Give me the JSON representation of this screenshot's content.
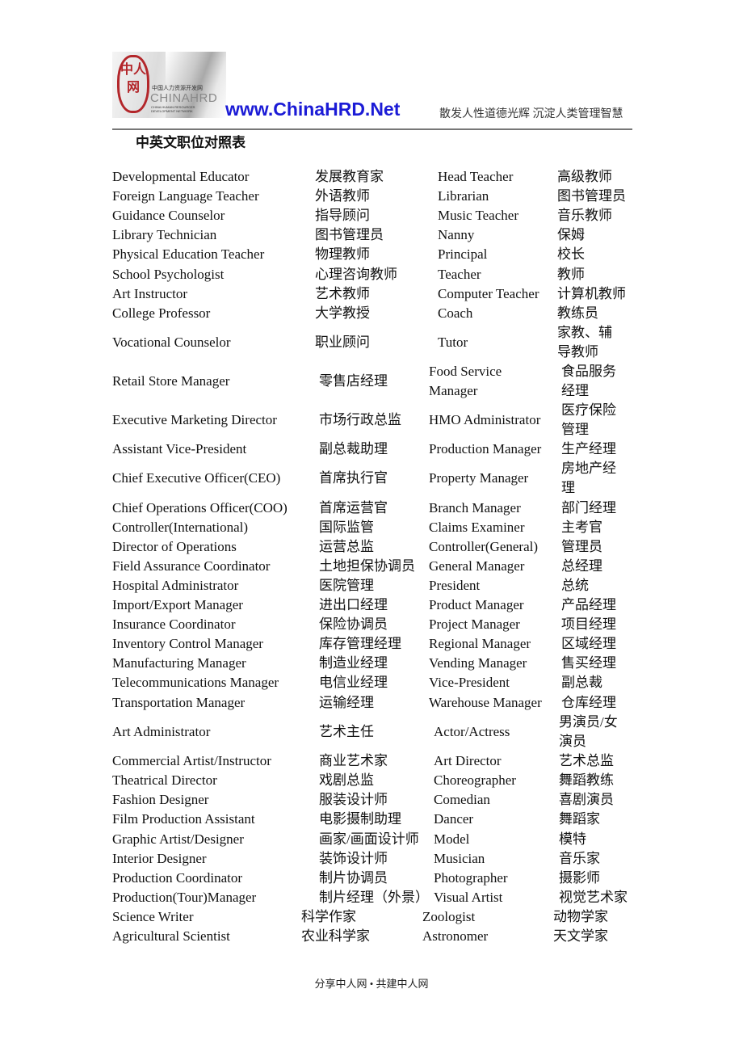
{
  "header": {
    "logo_text": "中人网",
    "logo_cn": "中国人力资源开发网",
    "logo_en": "CHINAHRD",
    "logo_sub": "CHINA HUMAN RESOURCES DEVELOPMENT NETWORK",
    "site": "www.ChinaHRD.Net",
    "slogan": "散发人性道德光辉 沉淀人类管理智慧"
  },
  "title": "中英文职位对照表",
  "rows": [
    [
      "Developmental Educator",
      "发展教育家",
      "Head Teacher",
      "高级教师"
    ],
    [
      "Foreign Language Teacher",
      "外语教师",
      "Librarian",
      "图书管理员"
    ],
    [
      "Guidance Counselor",
      "指导顾问",
      "Music Teacher",
      "音乐教师"
    ],
    [
      "Library Technician",
      "图书管理员",
      "Nanny",
      "保姆"
    ],
    [
      "Physical Education Teacher",
      "物理教师",
      "Principal",
      "校长"
    ],
    [
      "School Psychologist",
      "心理咨询教师",
      "Teacher",
      "教师"
    ],
    [
      "Art Instructor",
      "艺术教师",
      "Computer Teacher",
      "计算机教师"
    ],
    [
      "College Professor",
      "大学教授",
      "Coach",
      "教练员"
    ],
    [
      "Vocational Counselor",
      "职业顾问",
      "Tutor",
      "家教、辅导教师"
    ],
    [
      "Retail Store Manager",
      "零售店经理",
      "Food Service Manager",
      "食品服务经理"
    ],
    [
      "Executive Marketing Director",
      "市场行政总监",
      "HMO Administrator",
      "医疗保险管理"
    ],
    [
      "Assistant Vice-President",
      "副总裁助理",
      "Production Manager",
      "生产经理"
    ],
    [
      "Chief Executive Officer(CEO)",
      "首席执行官",
      "Property Manager",
      "房地产经理"
    ],
    [
      "Chief Operations Officer(COO)",
      "首席运营官",
      "Branch Manager",
      "部门经理"
    ],
    [
      "Controller(International)",
      "国际监管",
      "Claims Examiner",
      "主考官"
    ],
    [
      "Director of Operations",
      "运营总监",
      "Controller(General)",
      "管理员"
    ],
    [
      "Field Assurance Coordinator",
      "土地担保协调员",
      "General Manager",
      "总经理"
    ],
    [
      "Hospital Administrator",
      "医院管理",
      "President",
      "总统"
    ],
    [
      "Import/Export Manager",
      "进出口经理",
      "Product Manager",
      "产品经理"
    ],
    [
      "Insurance Coordinator",
      "保险协调员",
      "Project Manager",
      "项目经理"
    ],
    [
      "Inventory Control Manager",
      "库存管理经理",
      "Regional Manager",
      "区域经理"
    ],
    [
      "Manufacturing Manager",
      "制造业经理",
      "Vending Manager",
      "售买经理"
    ],
    [
      "Telecommunications Manager",
      "电信业经理",
      "Vice-President",
      "副总裁"
    ],
    [
      "Transportation Manager",
      "运输经理",
      "Warehouse Manager",
      "仓库经理"
    ],
    [
      "Art Administrator",
      "艺术主任",
      "Actor/Actress",
      "男演员/女演员"
    ],
    [
      "Commercial Artist/Instructor",
      "商业艺术家",
      "Art Director",
      "艺术总监"
    ],
    [
      "Theatrical Director",
      "戏剧总监",
      "Choreographer",
      "舞蹈教练"
    ],
    [
      "Fashion Designer",
      "服装设计师",
      "Comedian",
      "喜剧演员"
    ],
    [
      "Film Production Assistant",
      "电影摄制助理",
      "Dancer",
      "舞蹈家"
    ],
    [
      "Graphic Artist/Designer",
      "画家/画面设计师",
      "Model",
      "模特"
    ],
    [
      "Interior Designer",
      "装饰设计师",
      "Musician",
      "音乐家"
    ],
    [
      "Production Coordinator",
      "制片协调员",
      "Photographer",
      "摄影师"
    ],
    [
      "Production(Tour)Manager",
      "制片经理（外景）",
      "Visual Artist",
      "视觉艺术家"
    ],
    [
      "Science Writer",
      "科学作家",
      "Zoologist",
      "动物学家"
    ],
    [
      "Agricultural Scientist",
      "农业科学家",
      "Astronomer",
      "天文学家"
    ]
  ],
  "footer": "分享中人网 • 共建中人网"
}
